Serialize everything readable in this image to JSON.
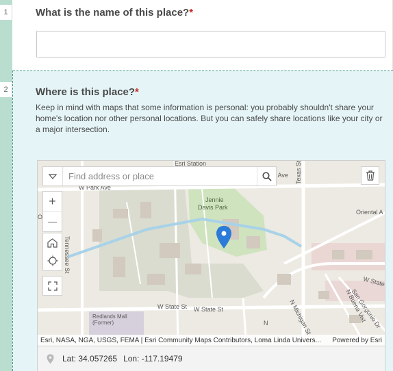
{
  "questions": [
    {
      "number": "1",
      "title": "What is the name of this place?",
      "required_mark": "*",
      "answer": ""
    },
    {
      "number": "2",
      "title": "Where is this place?",
      "required_mark": "*",
      "description": "Keep in mind with maps that some information is personal: you probably shouldn't share your home's location nor other personal locations. But you can safely share locations like your city or a major intersection."
    }
  ],
  "map": {
    "search_placeholder": "Find address or place",
    "zoom_in": "+",
    "zoom_out": "—",
    "attribution": "Esri, NASA, NGA, USGS, FEMA | Esri Community Maps Contributors, Loma Linda Univers...",
    "powered_by": "Powered by Esri",
    "labels": {
      "esri_station": "Esri Station",
      "w_park_ave": "W Park Ave",
      "park_ave_right": "Park Ave",
      "jennie_1": "Jennie",
      "jennie_2": "Davis Park",
      "oriental": "Oriental A",
      "tennessee": "Tennessee St",
      "texas": "Texas St",
      "w_state_st_1": "W State St",
      "w_state_st_2": "W State St",
      "w_state_right": "W State",
      "redlands_1": "Redlands Mall",
      "redlands_2": "(Former)",
      "n_michigan": "N Michigan St",
      "n_buena": "N Buena Vist",
      "san_gorgonio": "San Gorgonio Dr",
      "n_label": "N",
      "left_edge": "O/"
    },
    "colors": {
      "land": "#eceae2",
      "park": "#cfe3be",
      "water": "#a8d2e8",
      "road": "#ffffff",
      "building": "#dcd4cc",
      "residential": "#e9c9cc",
      "pin": "#2b7bd8"
    }
  },
  "coordinates": {
    "lat_label": "Lat: 34.057265",
    "lon_label": "Lon: -117.19479"
  }
}
